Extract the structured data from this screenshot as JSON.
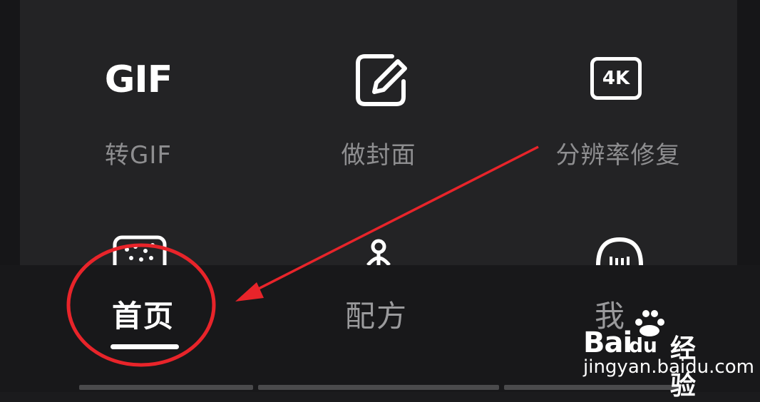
{
  "tools_row1": [
    {
      "icon": "gif-icon",
      "icon_text": "GIF",
      "label": "转GIF"
    },
    {
      "icon": "edit-icon",
      "label": "做封面"
    },
    {
      "icon": "4k-icon",
      "icon_text": "4K",
      "label": "分辨率修复"
    }
  ],
  "tools_row2_icons": [
    "dots-box-icon",
    "clip-icon",
    "face-icon"
  ],
  "tabs": [
    {
      "label": "首页",
      "active": true
    },
    {
      "label": "配方",
      "active": false
    },
    {
      "label": "我",
      "active": false
    }
  ],
  "watermark": {
    "brand_bai": "Bai",
    "brand_du": "du",
    "brand_suffix": "经验",
    "url": "jingyan.baidu.com"
  },
  "annotation": {
    "color": "#e8242a",
    "shape": "circle-and-arrow"
  },
  "colors": {
    "panel_bg": "#232325",
    "tabbar_bg": "#18181a",
    "active_text": "#ffffff",
    "inactive_text": "#9a9a9c"
  }
}
